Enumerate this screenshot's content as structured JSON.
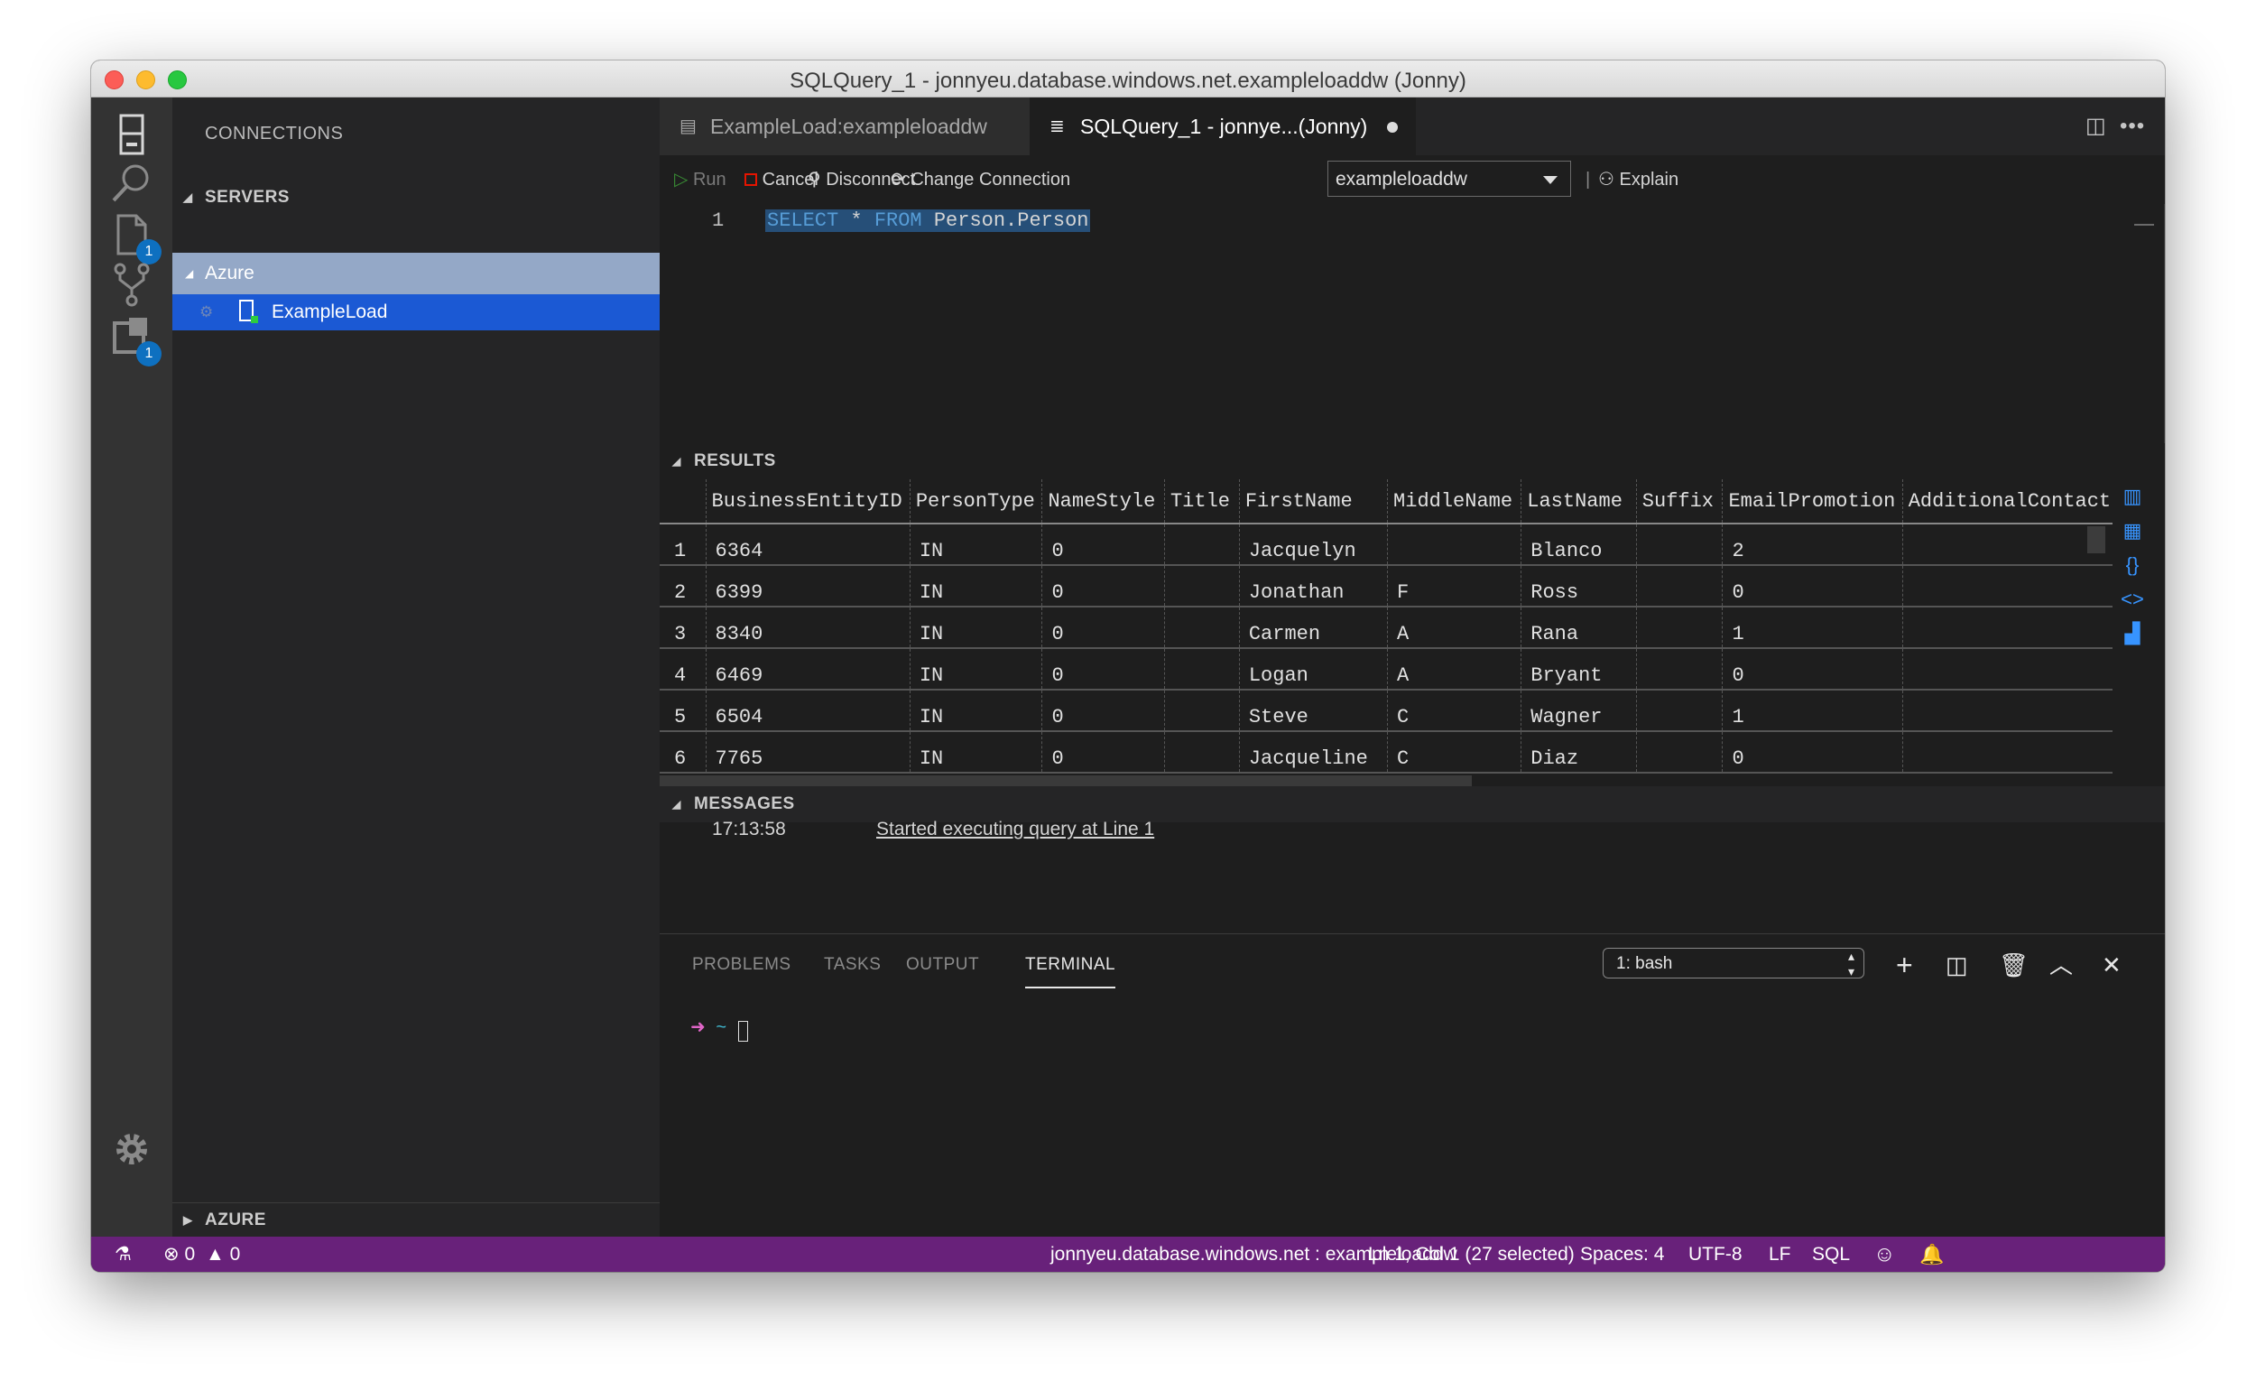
{
  "window": {
    "title": "SQLQuery_1 - jonnyeu.database.windows.net.exampleloaddw (Jonny)"
  },
  "activity_bar": {
    "explorer_badge": "1",
    "extensions_badge": "1"
  },
  "sidebar": {
    "header": "CONNECTIONS",
    "servers_section": "SERVERS",
    "group_name": "Azure",
    "connection_name": "ExampleLoad",
    "azure_section": "AZURE"
  },
  "tabs": [
    {
      "label": "ExampleLoad:exampleloaddw",
      "icon": "server-icon"
    },
    {
      "label": "SQLQuery_1 - jonnye...(Jonny)",
      "icon": "database-icon",
      "dirty": true
    }
  ],
  "toolbar": {
    "run": "Run",
    "cancel": "Cancel",
    "disconnect": "Disconnect",
    "change_connection": "Change Connection",
    "database": "exampleloaddw",
    "explain": "Explain"
  },
  "editor": {
    "line_number": "1",
    "kw_select": "SELECT",
    "star": " * ",
    "kw_from": "FROM",
    "table": " Person.Person"
  },
  "results": {
    "header": "RESULTS",
    "columns": [
      "BusinessEntityID",
      "PersonType",
      "NameStyle",
      "Title",
      "FirstName",
      "MiddleName",
      "LastName",
      "Suffix",
      "EmailPromotion",
      "AdditionalContact"
    ],
    "rows": [
      [
        "1",
        "6364",
        "IN",
        "0",
        "",
        "Jacquelyn",
        "",
        "Blanco",
        "",
        "2",
        ""
      ],
      [
        "2",
        "6399",
        "IN",
        "0",
        "",
        "Jonathan",
        "F",
        "Ross",
        "",
        "0",
        ""
      ],
      [
        "3",
        "8340",
        "IN",
        "0",
        "",
        "Carmen",
        "A",
        "Rana",
        "",
        "1",
        ""
      ],
      [
        "4",
        "6469",
        "IN",
        "0",
        "",
        "Logan",
        "A",
        "Bryant",
        "",
        "0",
        ""
      ],
      [
        "5",
        "6504",
        "IN",
        "0",
        "",
        "Steve",
        "C",
        "Wagner",
        "",
        "1",
        ""
      ],
      [
        "6",
        "7765",
        "IN",
        "0",
        "",
        "Jacqueline",
        "C",
        "Diaz",
        "",
        "0",
        ""
      ]
    ]
  },
  "messages": {
    "header": "MESSAGES",
    "time": "17:13:58",
    "text": "Started executing query at Line 1"
  },
  "panel": {
    "tabs": [
      "PROBLEMS",
      "TASKS",
      "OUTPUT",
      "TERMINAL"
    ],
    "active_tab": "TERMINAL",
    "terminal_select": "1: bash",
    "prompt_arrow": "➜",
    "prompt_dir": "~"
  },
  "statusbar": {
    "errors": "0",
    "warnings": "0",
    "connection": "jonnyeu.database.windows.net : exampleloaddw",
    "position": "Ln 1, Col 1 (27 selected)",
    "spaces": "Spaces: 4",
    "encoding": "UTF-8",
    "eol": "LF",
    "language": "SQL"
  },
  "colors": {
    "statusbar": "#68217a",
    "selection": "#1b59d4",
    "keyword": "#569cd6",
    "badge": "#0e70c0"
  }
}
